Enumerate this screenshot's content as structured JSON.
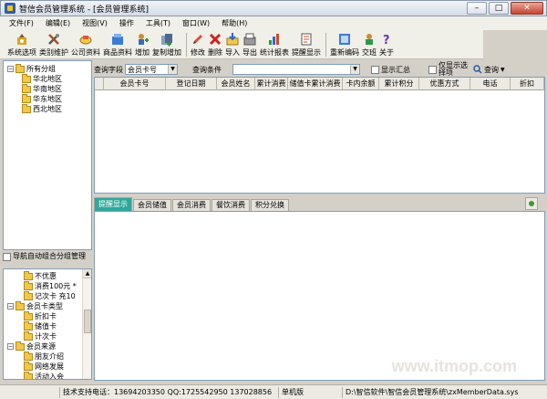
{
  "window": {
    "title": "智信会员管理系统 - [会员管理系统]"
  },
  "menu": [
    "文件(F)",
    "编辑(E)",
    "视图(V)",
    "操作",
    "工具(T)",
    "窗口(W)",
    "帮助(H)"
  ],
  "toolbar": [
    {
      "label": "系统选项",
      "icon": "system-options-icon"
    },
    {
      "label": "类别维护",
      "icon": "category-maintenance-icon"
    },
    {
      "label": "公司资料",
      "icon": "company-info-icon"
    },
    {
      "label": "商品资料",
      "icon": "product-info-icon"
    },
    {
      "label": "增加",
      "icon": "add-icon"
    },
    {
      "label": "复制增加",
      "icon": "copy-add-icon"
    },
    {
      "label": "修改",
      "icon": "edit-icon"
    },
    {
      "label": "删除",
      "icon": "delete-icon"
    },
    {
      "label": "导入",
      "icon": "import-icon"
    },
    {
      "label": "导出",
      "icon": "export-icon"
    },
    {
      "label": "统计报表",
      "icon": "statistics-report-icon"
    },
    {
      "label": "提醒显示",
      "icon": "reminder-icon"
    },
    {
      "label": "重新编码",
      "icon": "recode-icon"
    },
    {
      "label": "交班",
      "icon": "shift-handover-icon"
    },
    {
      "label": "关于",
      "icon": "help-about-icon"
    }
  ],
  "tree": {
    "root": "所有分组",
    "items": [
      "华北地区",
      "华南地区",
      "华东地区",
      "西北地区"
    ]
  },
  "auto_group_label": "导航自动组合分组管理",
  "tree2": [
    {
      "label": "不优惠",
      "level": 2
    },
    {
      "label": "消费100元 *",
      "level": 2
    },
    {
      "label": "记次卡 充10",
      "level": 2
    },
    {
      "label": "会员卡类型",
      "level": 1
    },
    {
      "label": "折扣卡",
      "level": 2
    },
    {
      "label": "储值卡",
      "level": 2
    },
    {
      "label": "计次卡",
      "level": 2
    },
    {
      "label": "会员来源",
      "level": 1
    },
    {
      "label": "朋友介绍",
      "level": 2
    },
    {
      "label": "网络发展",
      "level": 2
    },
    {
      "label": "活动入会",
      "level": 2
    }
  ],
  "query": {
    "field_label": "查询字段",
    "field_value": "会员卡号",
    "condition_label": "查询条件",
    "condition_value": "",
    "show_summary": "显示汇总",
    "show_selected": "仅显示选择项",
    "query_button": "查询"
  },
  "grid": {
    "columns": [
      "会员卡号",
      "登记日期",
      "会员姓名",
      "累计消费",
      "储值卡累计消费",
      "卡内余额",
      "累计积分",
      "优惠方式",
      "电话",
      "折扣"
    ]
  },
  "tabs": [
    "提醒显示",
    "会员储值",
    "会员消费",
    "餐饮消费",
    "积分兑换"
  ],
  "active_tab": 0,
  "status": {
    "support": "技术支持电话：13694203350 QQ:1725542950 137028856",
    "edition": "单机版",
    "path": "D:\\智信软件\\智信会员管理系统\\zxMemberData.sys"
  },
  "watermark": "www.itmop.com",
  "colors": {
    "accent_tab": "#2fa79b",
    "title_gradient": "#d6dde8"
  }
}
